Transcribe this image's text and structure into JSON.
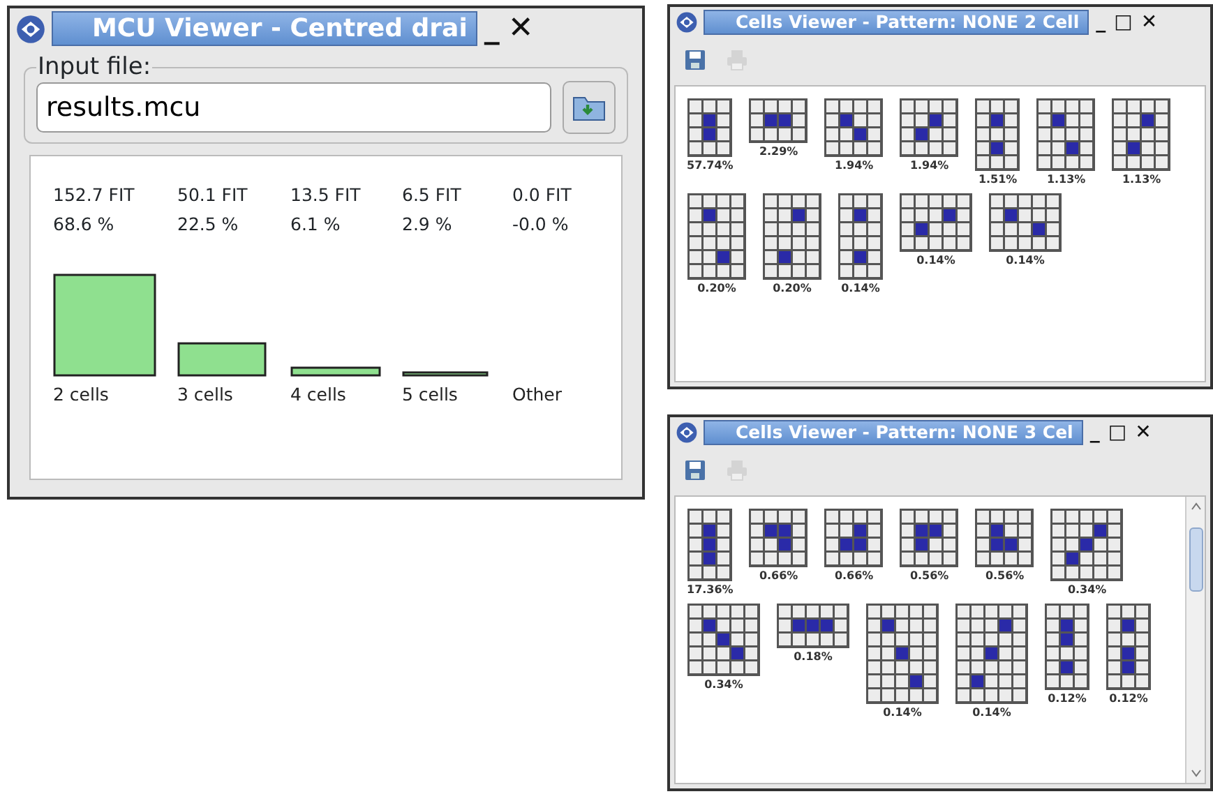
{
  "mcu_viewer": {
    "title": "MCU Viewer - Centred drai",
    "controls": [
      "_",
      "✕"
    ],
    "input_label": "Input file:",
    "input_value": "results.mcu",
    "fit_labels": [
      "152.7 FIT",
      "50.1 FIT",
      "13.5 FIT",
      "6.5 FIT",
      "0.0 FIT"
    ],
    "chart_data": {
      "type": "bar",
      "categories": [
        "2 cells",
        "3 cells",
        "4 cells",
        "5 cells",
        "Other"
      ],
      "values": [
        68.6,
        22.5,
        6.1,
        2.9,
        0.0
      ],
      "value_labels": [
        "68.6 %",
        "22.5 %",
        "6.1 %",
        "2.9 %",
        "-0.0 %"
      ]
    }
  },
  "cells_viewers": [
    {
      "title": "Cells Viewer - Pattern: NONE  2 Cell",
      "controls": [
        "_",
        "□",
        "✕"
      ],
      "toolbar": [
        {
          "kind": "save",
          "disabled": false
        },
        {
          "kind": "print",
          "disabled": true
        }
      ],
      "patterns": [
        {
          "cells": [
            [
              false,
              false,
              false
            ],
            [
              false,
              true,
              false
            ],
            [
              false,
              true,
              false
            ],
            [
              false,
              false,
              false
            ]
          ],
          "share": "57.74%"
        },
        {
          "cells": [
            [
              false,
              false,
              false,
              false
            ],
            [
              false,
              true,
              true,
              false
            ],
            [
              false,
              false,
              false,
              false
            ]
          ],
          "share": "2.29%"
        },
        {
          "cells": [
            [
              false,
              false,
              false,
              false
            ],
            [
              false,
              true,
              false,
              false
            ],
            [
              false,
              false,
              true,
              false
            ],
            [
              false,
              false,
              false,
              false
            ]
          ],
          "share": "1.94%"
        },
        {
          "cells": [
            [
              false,
              false,
              false,
              false
            ],
            [
              false,
              false,
              true,
              false
            ],
            [
              false,
              true,
              false,
              false
            ],
            [
              false,
              false,
              false,
              false
            ]
          ],
          "share": "1.94%"
        },
        {
          "cells": [
            [
              false,
              false,
              false
            ],
            [
              false,
              true,
              false
            ],
            [
              false,
              false,
              false
            ],
            [
              false,
              true,
              false
            ],
            [
              false,
              false,
              false
            ]
          ],
          "share": "1.51%"
        },
        {
          "cells": [
            [
              false,
              false,
              false,
              false
            ],
            [
              false,
              true,
              false,
              false
            ],
            [
              false,
              false,
              false,
              false
            ],
            [
              false,
              false,
              true,
              false
            ],
            [
              false,
              false,
              false,
              false
            ]
          ],
          "share": "1.13%"
        },
        {
          "cells": [
            [
              false,
              false,
              false,
              false
            ],
            [
              false,
              false,
              true,
              false
            ],
            [
              false,
              false,
              false,
              false
            ],
            [
              false,
              true,
              false,
              false
            ],
            [
              false,
              false,
              false,
              false
            ]
          ],
          "share": "1.13%"
        },
        {
          "cells": [
            [
              false,
              false,
              false,
              false
            ],
            [
              false,
              true,
              false,
              false
            ],
            [
              false,
              false,
              false,
              false
            ],
            [
              false,
              false,
              false,
              false
            ],
            [
              false,
              false,
              true,
              false
            ],
            [
              false,
              false,
              false,
              false
            ]
          ],
          "share": "0.20%"
        },
        {
          "cells": [
            [
              false,
              false,
              false,
              false
            ],
            [
              false,
              false,
              true,
              false
            ],
            [
              false,
              false,
              false,
              false
            ],
            [
              false,
              false,
              false,
              false
            ],
            [
              false,
              true,
              false,
              false
            ],
            [
              false,
              false,
              false,
              false
            ]
          ],
          "share": "0.20%"
        },
        {
          "cells": [
            [
              false,
              false,
              false
            ],
            [
              false,
              true,
              false
            ],
            [
              false,
              false,
              false
            ],
            [
              false,
              false,
              false
            ],
            [
              false,
              true,
              false
            ],
            [
              false,
              false,
              false
            ]
          ],
          "share": "0.14%"
        },
        {
          "cells": [
            [
              false,
              false,
              false,
              false,
              false
            ],
            [
              false,
              false,
              false,
              true,
              false
            ],
            [
              false,
              true,
              false,
              false,
              false
            ],
            [
              false,
              false,
              false,
              false,
              false
            ]
          ],
          "share": "0.14%"
        },
        {
          "cells": [
            [
              false,
              false,
              false,
              false,
              false
            ],
            [
              false,
              true,
              false,
              false,
              false
            ],
            [
              false,
              false,
              false,
              true,
              false
            ],
            [
              false,
              false,
              false,
              false,
              false
            ]
          ],
          "share": "0.14%"
        }
      ]
    },
    {
      "title": "Cells Viewer - Pattern: NONE  3 Cel",
      "controls": [
        "_",
        "□",
        "✕"
      ],
      "toolbar": [
        {
          "kind": "save",
          "disabled": false
        },
        {
          "kind": "print",
          "disabled": true
        }
      ],
      "scrollbar": true,
      "patterns": [
        {
          "cells": [
            [
              false,
              false,
              false
            ],
            [
              false,
              true,
              false
            ],
            [
              false,
              true,
              false
            ],
            [
              false,
              true,
              false
            ],
            [
              false,
              false,
              false
            ]
          ],
          "share": "17.36%"
        },
        {
          "cells": [
            [
              false,
              false,
              false,
              false
            ],
            [
              false,
              true,
              true,
              false
            ],
            [
              false,
              false,
              true,
              false
            ],
            [
              false,
              false,
              false,
              false
            ]
          ],
          "share": "0.66%"
        },
        {
          "cells": [
            [
              false,
              false,
              false,
              false
            ],
            [
              false,
              false,
              true,
              false
            ],
            [
              false,
              true,
              true,
              false
            ],
            [
              false,
              false,
              false,
              false
            ]
          ],
          "share": "0.66%"
        },
        {
          "cells": [
            [
              false,
              false,
              false,
              false
            ],
            [
              false,
              true,
              true,
              false
            ],
            [
              false,
              true,
              false,
              false
            ],
            [
              false,
              false,
              false,
              false
            ]
          ],
          "share": "0.56%"
        },
        {
          "cells": [
            [
              false,
              false,
              false,
              false
            ],
            [
              false,
              true,
              false,
              false
            ],
            [
              false,
              true,
              true,
              false
            ],
            [
              false,
              false,
              false,
              false
            ]
          ],
          "share": "0.56%"
        },
        {
          "cells": [
            [
              false,
              false,
              false,
              false,
              false
            ],
            [
              false,
              false,
              false,
              true,
              false
            ],
            [
              false,
              false,
              true,
              false,
              false
            ],
            [
              false,
              true,
              false,
              false,
              false
            ],
            [
              false,
              false,
              false,
              false,
              false
            ]
          ],
          "share": "0.34%"
        },
        {
          "cells": [
            [
              false,
              false,
              false,
              false,
              false
            ],
            [
              false,
              true,
              false,
              false,
              false
            ],
            [
              false,
              false,
              true,
              false,
              false
            ],
            [
              false,
              false,
              false,
              true,
              false
            ],
            [
              false,
              false,
              false,
              false,
              false
            ]
          ],
          "share": "0.34%"
        },
        {
          "cells": [
            [
              false,
              false,
              false,
              false,
              false
            ],
            [
              false,
              true,
              true,
              true,
              false
            ],
            [
              false,
              false,
              false,
              false,
              false
            ]
          ],
          "share": "0.18%"
        },
        {
          "cells": [
            [
              false,
              false,
              false,
              false,
              false
            ],
            [
              false,
              true,
              false,
              false,
              false
            ],
            [
              false,
              false,
              false,
              false,
              false
            ],
            [
              false,
              false,
              true,
              false,
              false
            ],
            [
              false,
              false,
              false,
              false,
              false
            ],
            [
              false,
              false,
              false,
              true,
              false
            ],
            [
              false,
              false,
              false,
              false,
              false
            ]
          ],
          "share": "0.14%"
        },
        {
          "cells": [
            [
              false,
              false,
              false,
              false,
              false
            ],
            [
              false,
              false,
              false,
              true,
              false
            ],
            [
              false,
              false,
              false,
              false,
              false
            ],
            [
              false,
              false,
              true,
              false,
              false
            ],
            [
              false,
              false,
              false,
              false,
              false
            ],
            [
              false,
              true,
              false,
              false,
              false
            ],
            [
              false,
              false,
              false,
              false,
              false
            ]
          ],
          "share": "0.14%"
        },
        {
          "cells": [
            [
              false,
              false,
              false
            ],
            [
              false,
              true,
              false
            ],
            [
              false,
              true,
              false
            ],
            [
              false,
              false,
              false
            ],
            [
              false,
              true,
              false
            ],
            [
              false,
              false,
              false
            ]
          ],
          "share": "0.12%"
        },
        {
          "cells": [
            [
              false,
              false,
              false
            ],
            [
              false,
              true,
              false
            ],
            [
              false,
              false,
              false
            ],
            [
              false,
              true,
              false
            ],
            [
              false,
              true,
              false
            ],
            [
              false,
              false,
              false
            ]
          ],
          "share": "0.12%"
        }
      ]
    }
  ]
}
